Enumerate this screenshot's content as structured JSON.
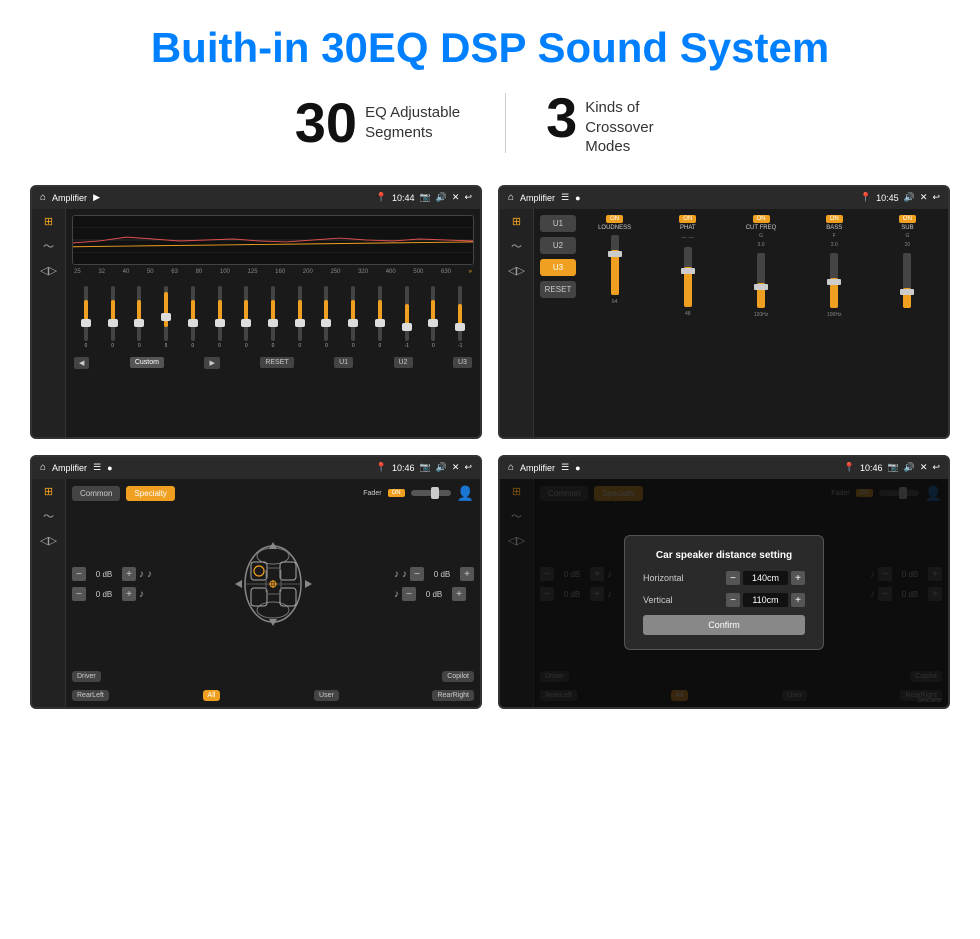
{
  "header": {
    "title": "Buith-in 30EQ DSP Sound System"
  },
  "stats": [
    {
      "number": "30",
      "label": "EQ Adjustable\nSegments"
    },
    {
      "number": "3",
      "label": "Kinds of\nCrossover Modes"
    }
  ],
  "screens": {
    "eq1": {
      "title": "Amplifier",
      "time": "10:44",
      "eq_freqs": [
        "25",
        "32",
        "40",
        "50",
        "63",
        "80",
        "100",
        "125",
        "160",
        "200",
        "250",
        "320",
        "400",
        "500",
        "630"
      ],
      "eq_values": [
        0,
        0,
        0,
        5,
        0,
        0,
        0,
        0,
        0,
        0,
        0,
        0,
        -1,
        0,
        -1
      ],
      "presets": [
        "Custom",
        "RESET",
        "U1",
        "U2",
        "U3"
      ]
    },
    "crossover": {
      "title": "Amplifier",
      "time": "10:45",
      "presets": [
        "U1",
        "U2",
        "U3"
      ],
      "active_preset": "U3",
      "channels": [
        "LOUDNESS",
        "PHAT",
        "CUT FREQ",
        "BASS",
        "SUB"
      ],
      "reset_label": "RESET"
    },
    "speaker": {
      "title": "Amplifier",
      "time": "10:46",
      "modes": [
        "Common",
        "Specialty"
      ],
      "active_mode": "Specialty",
      "fader_label": "Fader",
      "fader_on": "ON",
      "db_values": [
        "0 dB",
        "0 dB",
        "0 dB",
        "0 dB"
      ],
      "positions": [
        "Driver",
        "RearLeft",
        "All",
        "User",
        "Copilot",
        "RearRight"
      ]
    },
    "speaker_distance": {
      "title": "Amplifier",
      "time": "10:46",
      "modes": [
        "Common",
        "Specialty"
      ],
      "active_mode": "Specialty",
      "dialog": {
        "title": "Car speaker distance setting",
        "horizontal_label": "Horizontal",
        "horizontal_value": "140cm",
        "vertical_label": "Vertical",
        "vertical_value": "110cm",
        "confirm_label": "Confirm"
      },
      "positions": [
        "Driver",
        "RearLeft",
        "All",
        "User",
        "Copilot",
        "RearRight"
      ]
    }
  },
  "watermark": "Seicane"
}
